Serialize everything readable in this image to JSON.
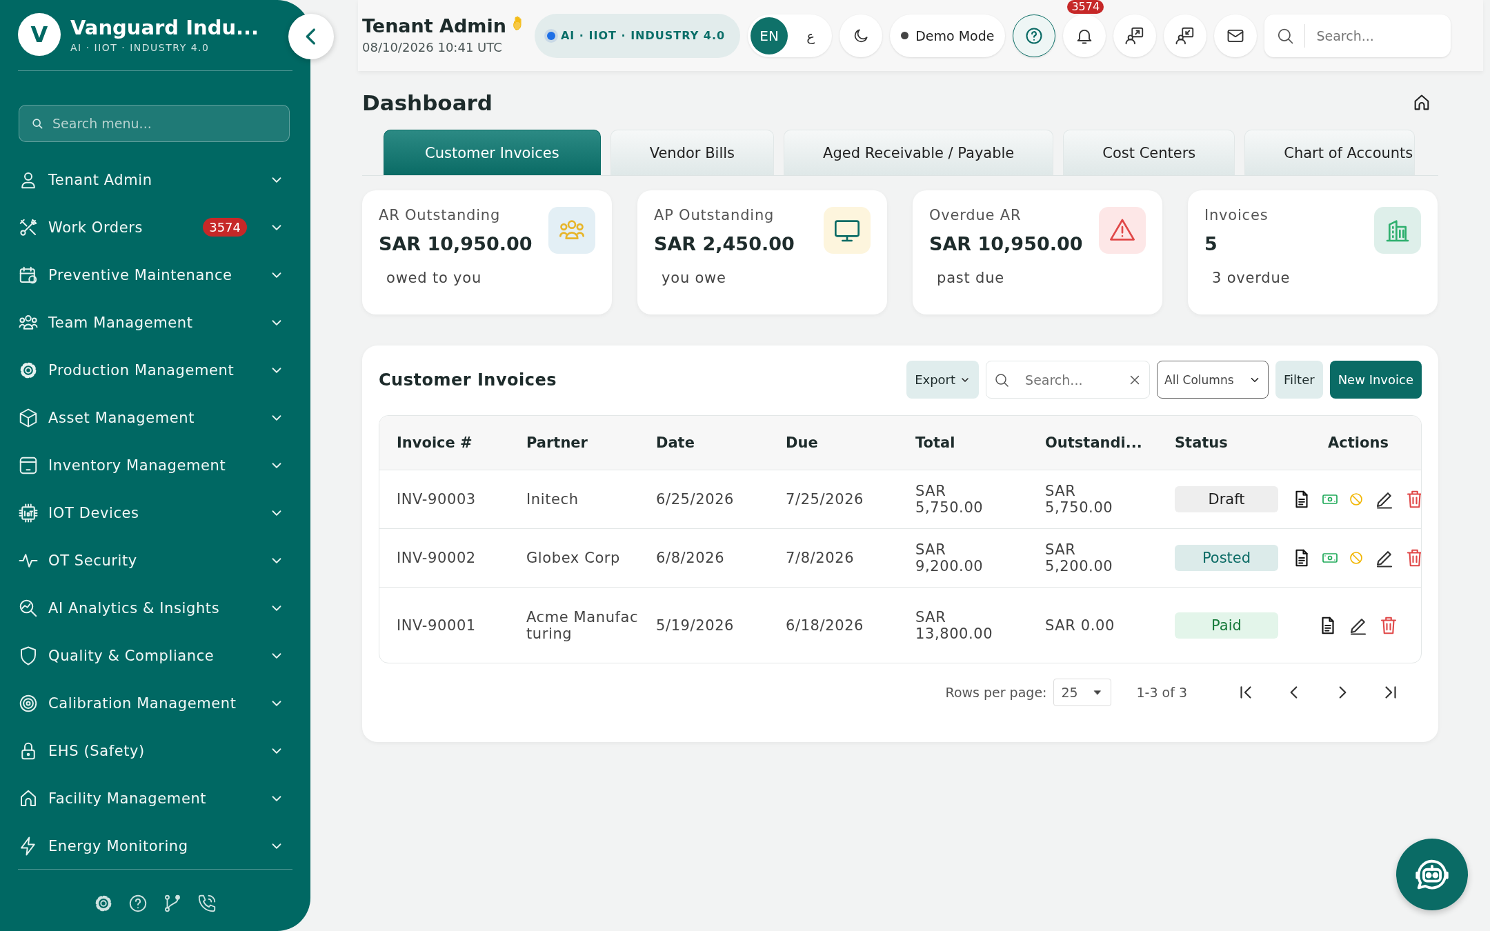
{
  "sidebar": {
    "brand": {
      "logo_letter": "V",
      "name": "Vanguard Indu...",
      "tagline": "AI · IIOT · INDUSTRY 4.0"
    },
    "search": {
      "placeholder": "Search menu..."
    },
    "items": [
      {
        "label": "Tenant Admin",
        "expanded": false
      },
      {
        "label": "Work Orders",
        "badge": "3574",
        "expanded": false
      },
      {
        "label": "Preventive Maintenance",
        "expanded": false
      },
      {
        "label": "Team Management",
        "expanded": false
      },
      {
        "label": "Production Management",
        "expanded": false
      },
      {
        "label": "Asset Management",
        "expanded": false
      },
      {
        "label": "Inventory Management",
        "expanded": false
      },
      {
        "label": "IOT Devices",
        "expanded": false
      },
      {
        "label": "OT Security",
        "expanded": false
      },
      {
        "label": "AI Analytics & Insights",
        "expanded": false
      },
      {
        "label": "Quality & Compliance",
        "expanded": false
      },
      {
        "label": "Calibration Management",
        "expanded": false
      },
      {
        "label": "EHS (Safety)",
        "expanded": false
      },
      {
        "label": "Facility Management",
        "expanded": false
      },
      {
        "label": "Energy Monitoring",
        "expanded": false
      }
    ]
  },
  "header": {
    "title": "Tenant Admin",
    "datetime": "08/10/2026 10:41 UTC",
    "chip": "AI · IIOT · INDUSTRY 4.0",
    "languages": [
      {
        "label": "EN",
        "selected": true
      },
      {
        "label": "ع",
        "selected": false
      }
    ],
    "demo_mode": "Demo Mode",
    "notifications": "3574",
    "search": {
      "placeholder": "Search..."
    }
  },
  "page": {
    "title": "Dashboard"
  },
  "tabs": [
    {
      "label": "Customer Invoices",
      "selected": true
    },
    {
      "label": "Vendor Bills",
      "selected": false
    },
    {
      "label": "Aged Receivable / Payable",
      "selected": false
    },
    {
      "label": "Cost Centers",
      "selected": false
    },
    {
      "label": "Chart of Accounts",
      "selected": false
    }
  ],
  "cards": [
    {
      "label": "AR Outstanding",
      "value": "SAR 10,950.00",
      "note": "owed to you"
    },
    {
      "label": "AP Outstanding",
      "value": "SAR 2,450.00",
      "note": "you owe"
    },
    {
      "label": "Overdue AR",
      "value": "SAR 10,950.00",
      "note": "past due"
    },
    {
      "label": "Invoices",
      "value": "5",
      "note": "3 overdue"
    }
  ],
  "table": {
    "title": "Customer Invoices",
    "toolbar": {
      "export": "Export",
      "search_placeholder": "Search...",
      "column_filter": "All Columns",
      "filter": "Filter",
      "new": "New Invoice"
    },
    "columns": [
      "Invoice #",
      "Partner",
      "Date",
      "Due",
      "Total",
      "Outstandi...",
      "Status",
      "Actions"
    ],
    "rows": [
      {
        "cells": [
          "INV-90003",
          "Initech",
          "6/25/2026",
          "7/25/2026",
          "SAR 5,750.00",
          "SAR 5,750.00"
        ],
        "status": {
          "label": "Draft",
          "kind": "draft"
        },
        "open": true
      },
      {
        "cells": [
          "INV-90002",
          "Globex Corp",
          "6/8/2026",
          "7/8/2026",
          "SAR 9,200.00",
          "SAR 5,200.00"
        ],
        "status": {
          "label": "Posted",
          "kind": "posted"
        },
        "open": true
      },
      {
        "cells": [
          "INV-90001",
          "Acme Manufacturing",
          "5/19/2026",
          "6/18/2026",
          "SAR 13,800.00",
          "SAR 0.00"
        ],
        "status": {
          "label": "Paid",
          "kind": "paid"
        },
        "open": false
      }
    ],
    "pagination": {
      "rows_label": "Rows per page:",
      "rows_value": "25",
      "range": "1-3 of 3"
    }
  }
}
